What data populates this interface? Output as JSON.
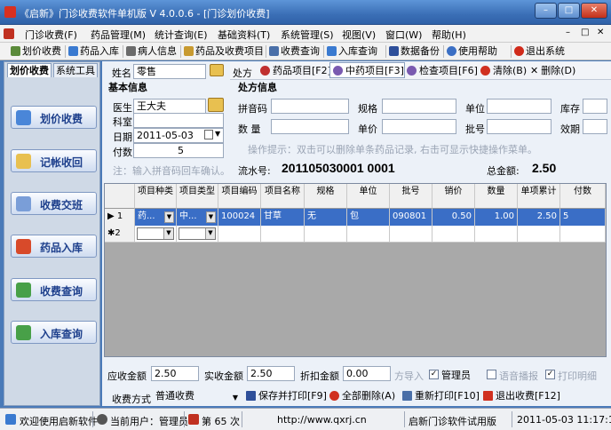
{
  "window": {
    "title": "《启新》门诊收费软件单机版 V 4.0.0.6 - [门诊划价收费]",
    "minimize": "–",
    "maximize": "□",
    "close": "✕"
  },
  "menu": {
    "items": [
      "门诊收费(F)",
      "药品管理(M)",
      "统计查询(E)",
      "基础资料(T)",
      "系统管理(S)",
      "视图(V)",
      "窗口(W)",
      "帮助(H)"
    ],
    "mdi_controls": [
      "–",
      "□",
      "✕"
    ]
  },
  "toolbar": {
    "items": [
      "划价收费",
      "药品入库",
      "病人信息",
      "药品及收费项目",
      "收费查询",
      "入库查询",
      "数据备份",
      "使用帮助",
      "退出系统"
    ]
  },
  "left": {
    "tabs": [
      "划价收费",
      "系统工具"
    ],
    "nav": [
      "划价收费",
      "记帐收回",
      "收费交班",
      "药品入库",
      "收费查询",
      "入库查询"
    ]
  },
  "patient": {
    "name_label": "姓名",
    "name_value": "零售",
    "section": "基本信息",
    "doctor_label": "医生",
    "doctor_value": "王大夫",
    "dept_label": "科室",
    "dept_value": "",
    "date_label": "日期",
    "date_value": "2011-05-03",
    "doses_label": "付数",
    "doses_value": "5",
    "hint": "注：输入拼音码回车确认。"
  },
  "rx_tabs": {
    "label": "处方",
    "items": [
      "药品项目[F2]",
      "中药项目[F3]",
      "检查项目[F6]",
      "清除(B)",
      "删除(D)"
    ]
  },
  "rx_info": {
    "section": "处方信息",
    "pinyin_label": "拼音码",
    "spec_label": "规格",
    "unit_label": "单位",
    "stock_label": "库存",
    "qty_label": "数 量",
    "price_label": "单价",
    "batch_label": "批号",
    "expiry_label": "效期",
    "tip": "操作提示：双击可以删除单条药品记录, 右击可显示快捷操作菜单。",
    "serial_label": "流水号:",
    "serial_value": "201105030001 0001",
    "total_label": "总金额:",
    "total_value": "2.50"
  },
  "grid": {
    "headers": [
      "项目种类",
      "项目类型",
      "项目编码",
      "项目名称",
      "规格",
      "单位",
      "批号",
      "销价",
      "数量",
      "单项累计",
      "付数"
    ],
    "rows": [
      {
        "marker": "▶",
        "num": "1",
        "kind": "药...",
        "type": "中...",
        "code": "100024",
        "name": "甘草",
        "spec": "无",
        "unit": "包",
        "batch": "090801",
        "price": "0.50",
        "qty": "1.00",
        "subtotal": "2.50",
        "doses": "5"
      }
    ],
    "new_row": {
      "marker": "✱",
      "num": "2"
    }
  },
  "bottom": {
    "due_label": "应收金额",
    "due_value": "2.50",
    "paid_label": "实收金额",
    "paid_value": "2.50",
    "discount_label": "折扣金额",
    "discount_value": "0.00",
    "import_label": "方导入",
    "admin_label": "管理员",
    "voice_label": "语音播报",
    "print_detail_label": "打印明细",
    "pay_label": "收费方式",
    "pay_value": "普通收费",
    "buttons": [
      "保存并打印[F9]",
      "全部删除(A)",
      "重新打印[F10]",
      "退出收费[F12]"
    ]
  },
  "status": {
    "welcome": "欢迎使用启新软件",
    "user": "当前用户：管理员",
    "count": "第 65 次",
    "url": "http://www.qxrj.cn",
    "edition": "启新门诊软件试用版",
    "datetime": "2011-05-03 11:17:14"
  },
  "colors": {
    "selection": "#3a6ec6",
    "nav_text": "#1d3f8c",
    "hint": "#9aa4b4"
  }
}
